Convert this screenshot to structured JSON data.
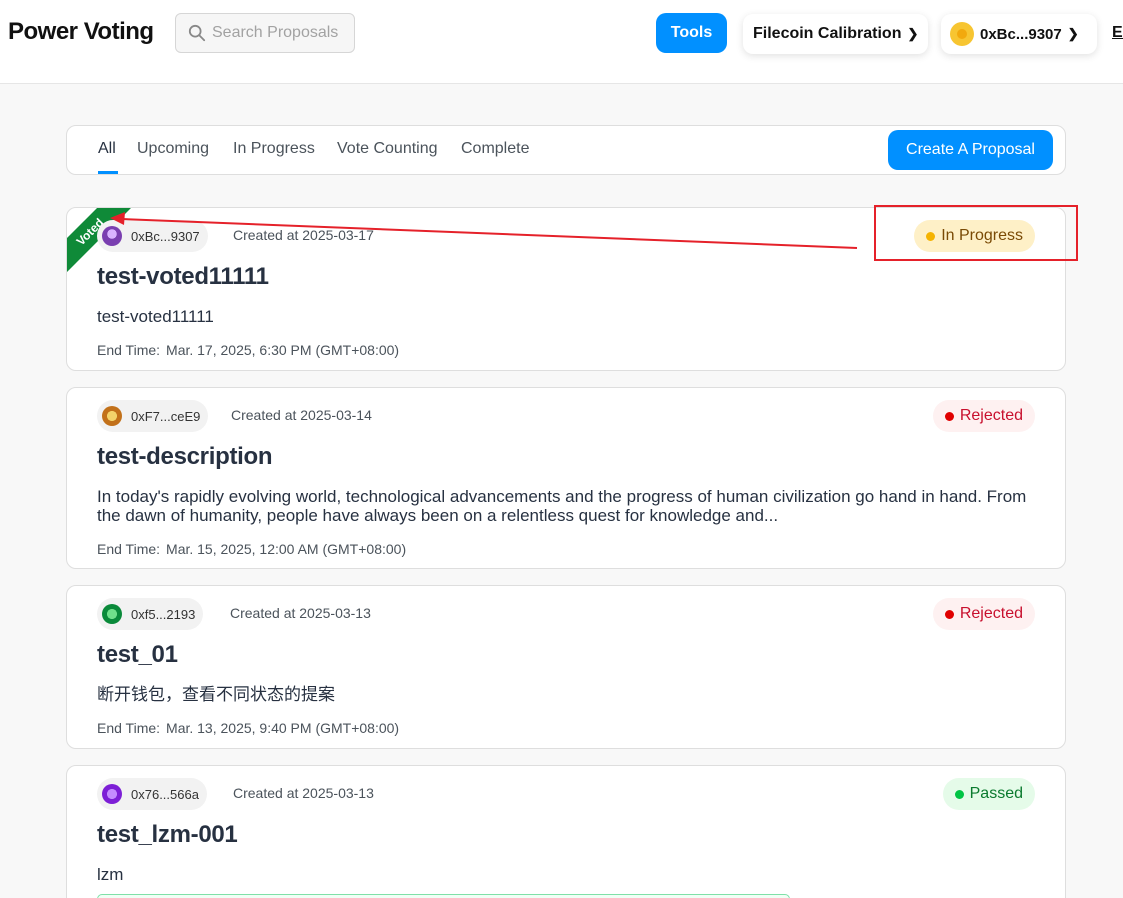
{
  "header": {
    "logo": "Power Voting",
    "search_placeholder": "Search Proposals",
    "tools_label": "Tools",
    "network_label": "Filecoin Calibration",
    "wallet_label": "0xBc...9307",
    "lang_label": "EN"
  },
  "tabs": {
    "items": [
      "All",
      "Upcoming",
      "In Progress",
      "Vote Counting",
      "Complete"
    ],
    "active": "All",
    "create_label": "Create A Proposal"
  },
  "proposals": [
    {
      "address": "0xBc...9307",
      "created": "Created at 2025-03-17",
      "status": "In Progress",
      "title": "test-voted11111",
      "description": "test-voted11111",
      "end_label": "End Time:",
      "end_time": "Mar. 17, 2025, 6:30 PM (GMT+08:00)",
      "voted_badge": "Voted"
    },
    {
      "address": "0xF7...ceE9",
      "created": "Created at 2025-03-14",
      "status": "Rejected",
      "title": "test-description",
      "description": "In today's rapidly evolving world, technological advancements and the progress of human civilization go hand in hand. From the dawn of humanity, people have always been on a relentless quest for knowledge and...",
      "end_label": "End Time:",
      "end_time": "Mar. 15, 2025, 12:00 AM (GMT+08:00)"
    },
    {
      "address": "0xf5...2193",
      "created": "Created at 2025-03-13",
      "status": "Rejected",
      "title": "test_01",
      "description": "断开钱包，查看不同状态的提案",
      "end_label": "End Time:",
      "end_time": "Mar. 13, 2025, 9:40 PM (GMT+08:00)"
    },
    {
      "address": "0x76...566a",
      "created": "Created at 2025-03-13",
      "status": "Passed",
      "title": "test_lzm-001",
      "description": "lzm"
    }
  ],
  "colors": {
    "accent": "#0190ff",
    "annotation": "#e5212a",
    "voted": "#0f8a38"
  },
  "icons": {
    "search": "search-icon",
    "chevron": "chevron-down-icon",
    "coin": "wallet-coin-icon"
  }
}
